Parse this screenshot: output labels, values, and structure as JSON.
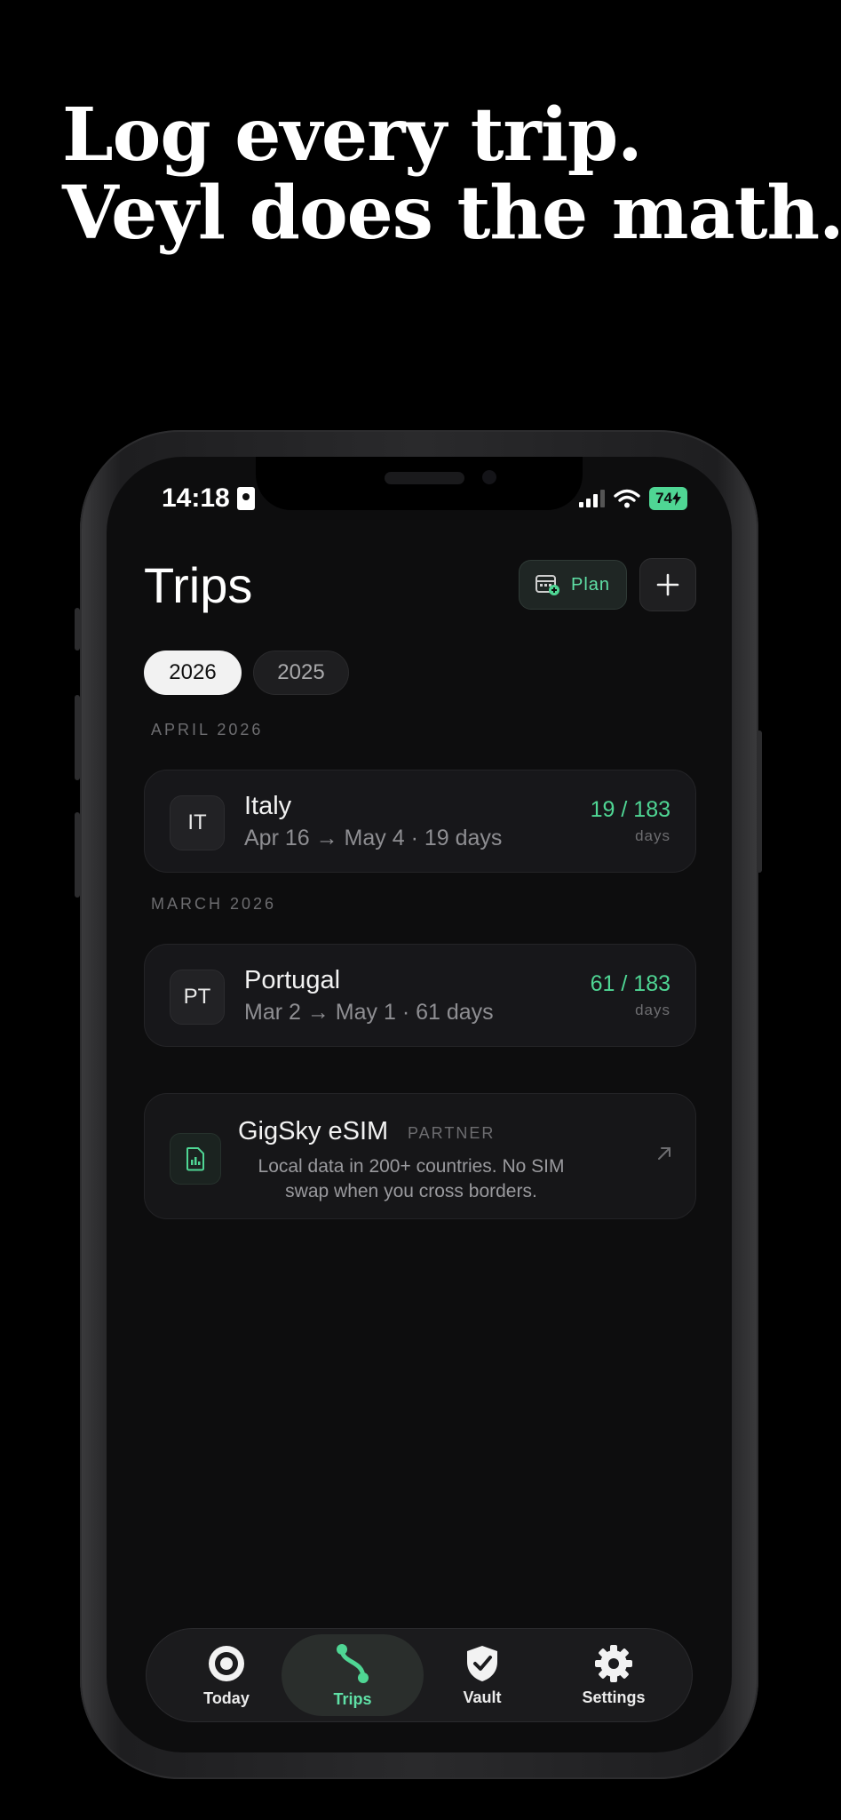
{
  "headline": {
    "line1": "Log every trip.",
    "line2": "Veyl does the math."
  },
  "status_bar": {
    "time": "14:18",
    "battery": "74"
  },
  "header": {
    "title": "Trips",
    "plan_label": "Plan"
  },
  "year_filter": {
    "years": [
      "2026",
      "2025"
    ],
    "selected": "2026"
  },
  "sections": [
    {
      "label": "APRIL 2026",
      "trip": {
        "code": "IT",
        "country": "Italy",
        "dates": "Apr 16 → May 4 · 19 days",
        "count": "19 / 183",
        "unit": "days"
      }
    },
    {
      "label": "MARCH 2026",
      "trip": {
        "code": "PT",
        "country": "Portugal",
        "dates": "Mar 2 → May 1 · 61 days",
        "count": "61 / 183",
        "unit": "days"
      }
    }
  ],
  "partner": {
    "name": "GigSky eSIM",
    "tag": "PARTNER",
    "description": "Local data in 200+ countries. No SIM swap when you cross borders."
  },
  "tabbar": {
    "tabs": [
      {
        "label": "Today",
        "icon": "target-icon"
      },
      {
        "label": "Trips",
        "icon": "route-icon"
      },
      {
        "label": "Vault",
        "icon": "shield-check-icon"
      },
      {
        "label": "Settings",
        "icon": "gear-icon"
      }
    ],
    "active": "Trips"
  },
  "colors": {
    "accent": "#4fd694",
    "background": "#0d0d0e",
    "card": "#17171a"
  }
}
